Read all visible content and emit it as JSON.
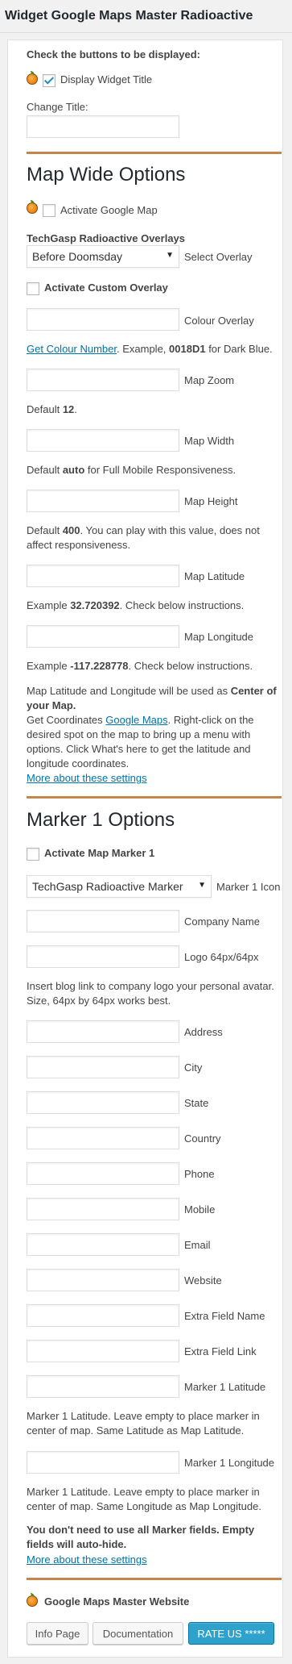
{
  "header": {
    "title": "Widget Google Maps Master Radioactive"
  },
  "top": {
    "check_buttons_label": "Check the buttons to be displayed:",
    "display_title_label": "Display Widget Title",
    "display_title_checked": true,
    "change_title_label": "Change Title:"
  },
  "map_wide": {
    "heading": "Map Wide Options",
    "activate_google_map": "Activate Google Map",
    "overlays_label": "TechGasp Radioactive Overlays",
    "overlay_selected": "Before Doomsday",
    "select_overlay_label": "Select Overlay",
    "activate_custom_overlay": "Activate Custom Overlay",
    "colour_overlay_label": "Colour Overlay",
    "colour_link": "Get Colour Number",
    "colour_hint_pre": ". Example, ",
    "colour_hint_code": "0018D1",
    "colour_hint_post": " for Dark Blue.",
    "zoom_label": "Map Zoom",
    "zoom_default_pre": "Default ",
    "zoom_default_val": "12",
    "zoom_default_post": ".",
    "width_label": "Map Width",
    "width_default_pre": "Default ",
    "width_default_val": "auto",
    "width_default_post": " for Full Mobile Responsiveness.",
    "height_label": "Map Height",
    "height_default_pre": "Default ",
    "height_default_val": "400",
    "height_default_post": ". You can play with this value, does not affect responsiveness.",
    "latitude_label": "Map Latitude",
    "latitude_example_pre": "Example ",
    "latitude_example_val": "32.720392",
    "latitude_example_post": ". Check below instructions.",
    "longitude_label": "Map Longitude",
    "longitude_example_pre": "Example ",
    "longitude_example_val": "-117.228778",
    "longitude_example_post": ". Check below instructions.",
    "center_note_pre": "Map Latitude and Longitude will be used as ",
    "center_note_bold": "Center of your Map.",
    "coords_pre": "Get Coordinates ",
    "coords_link": "Google Maps",
    "coords_post": ". Right-click on the desired spot on the map to bring up a menu with options. Click What's here to get the latitude and longitude coordinates.",
    "more_settings_link": "More about these settings"
  },
  "marker": {
    "heading": "Marker 1 Options",
    "activate_marker": "Activate Map Marker 1",
    "icon_selected": "TechGasp Radioactive Marker",
    "icon_label": "Marker 1 Icon",
    "company_name": "Company Name",
    "logo": "Logo 64px/64px",
    "logo_hint": "Insert blog link to company logo your personal avatar. Size, 64px by 64px works best.",
    "address": "Address",
    "city": "City",
    "state": "State",
    "country": "Country",
    "phone": "Phone",
    "mobile": "Mobile",
    "email": "Email",
    "website": "Website",
    "extra_field_name": "Extra Field Name",
    "extra_field_link": "Extra Field Link",
    "marker_latitude": "Marker 1 Latitude",
    "marker_latitude_hint": "Marker 1 Latitude. Leave empty to place marker in center of map. Same Latitude as Map Latitude.",
    "marker_longitude": "Marker 1 Longitude",
    "marker_longitude_hint": "Marker 1 Latitude. Leave empty to place marker in center of map. Same Longitude as Map Longitude.",
    "autohide_note": "You don't need to use all Marker fields. Empty fields will auto-hide.",
    "more_settings_link": "More about these settings"
  },
  "footer": {
    "website_label": "Google Maps Master Website",
    "info_button": "Info Page",
    "docs_button": "Documentation",
    "rate_button": "RATE US *****"
  },
  "colors": {
    "accent": "#c4864a",
    "link": "#0073aa",
    "primary_button": "#2ea2cc"
  }
}
